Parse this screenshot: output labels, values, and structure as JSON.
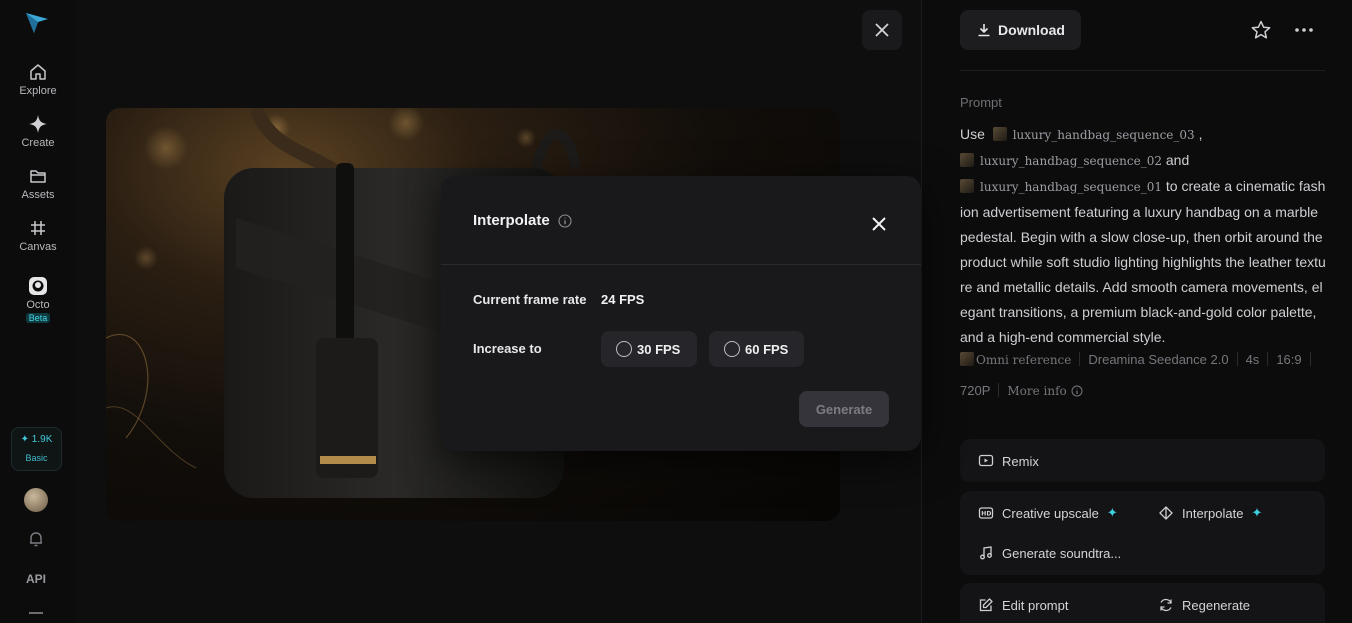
{
  "sidebar": {
    "items": [
      {
        "label": "Explore"
      },
      {
        "label": "Create"
      },
      {
        "label": "Assets"
      },
      {
        "label": "Canvas"
      },
      {
        "label": "Octo",
        "badge": "Beta"
      }
    ],
    "credits": {
      "amount": "1.9K",
      "plan": "Basic"
    },
    "api_label": "API"
  },
  "panel": {
    "download_label": "Download",
    "prompt_title": "Prompt",
    "prompt": {
      "prefix": "Use",
      "ref1": "luxury_handbag_sequence_03",
      "comma": ",",
      "ref2": "luxury_handbag_sequence_02",
      "and": "and",
      "ref3": "luxury_handbag_sequence_01",
      "text": "to create a cinematic fashion advertisement featuring a luxury handbag on a marble pedestal. Begin with a slow close-up, then orbit around the product while soft studio lighting highlights the leather texture and metallic details. Add smooth camera movements, elegant transitions, a premium black-and-gold color palette, and a high-end commercial style."
    },
    "meta": {
      "omni_reference": "Omni reference",
      "model": "Dreamina Seedance 2.0",
      "duration": "4s",
      "ratio": "16:9",
      "resolution": "720P",
      "more_info": "More info"
    },
    "actions": {
      "remix": "Remix",
      "creative_upscale": "Creative upscale",
      "interpolate": "Interpolate",
      "generate_soundtrack": "Generate soundtra...",
      "edit_prompt": "Edit prompt",
      "regenerate": "Regenerate"
    }
  },
  "modal": {
    "title": "Interpolate",
    "current_label": "Current frame rate",
    "current_value": "24 FPS",
    "increase_label": "Increase to",
    "options": [
      "30 FPS",
      "60 FPS"
    ],
    "generate_label": "Generate"
  },
  "colors": {
    "accent": "#3fd0e0",
    "background": "#0b0b0c",
    "modal_bg": "#19191c"
  }
}
